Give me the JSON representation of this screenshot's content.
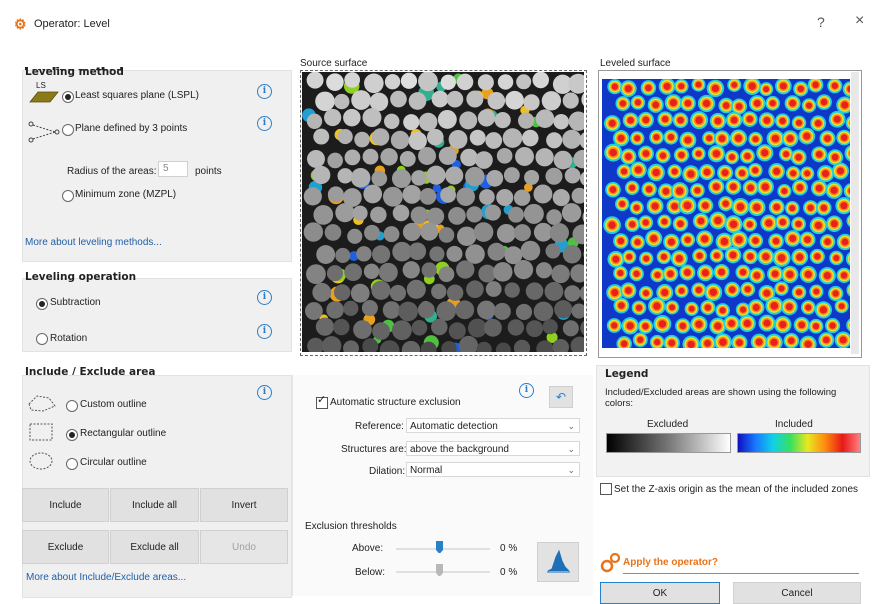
{
  "window": {
    "title": "Operator: Level",
    "help_glyph": "?",
    "close_glyph": "×"
  },
  "colors": {
    "accent": "#e8731a",
    "link": "#1f5fa8",
    "info": "#2a7fc9",
    "panel": "#f0f0f0"
  },
  "leveling_method": {
    "title": "Leveling method",
    "ls_badge": "LS",
    "options": [
      {
        "label": "Least squares plane (LSPL)",
        "selected": true
      },
      {
        "label": "Plane defined by 3 points",
        "selected": false
      },
      {
        "label": "Minimum zone (MZPL)",
        "selected": false
      }
    ],
    "radius_label": "Radius of the areas:",
    "radius_value": "5",
    "radius_unit": "points",
    "more_link": "More about leveling methods..."
  },
  "leveling_operation": {
    "title": "Leveling operation",
    "options": [
      {
        "label": "Subtraction",
        "selected": true
      },
      {
        "label": "Rotation",
        "selected": false
      }
    ]
  },
  "include_exclude": {
    "title": "Include / Exclude area",
    "options": [
      {
        "label": "Custom outline",
        "selected": false
      },
      {
        "label": "Rectangular outline",
        "selected": true
      },
      {
        "label": "Circular outline",
        "selected": false
      }
    ],
    "buttons": [
      "Include",
      "Include all",
      "Invert",
      "Exclude",
      "Exclude all",
      "Undo"
    ],
    "more_link": "More about Include/Exclude areas..."
  },
  "source_surface": {
    "title": "Source surface"
  },
  "leveled_surface": {
    "title": "Leveled surface"
  },
  "structure": {
    "auto_exclusion_label": "Automatic structure exclusion",
    "auto_exclusion_checked": true,
    "reference_label": "Reference:",
    "reference_value": "Automatic detection",
    "structures_label": "Structures are:",
    "structures_value": "above the background",
    "dilation_label": "Dilation:",
    "dilation_value": "Normal",
    "thresholds_title": "Exclusion thresholds",
    "above_label": "Above:",
    "above_value": "0 %",
    "below_label": "Below:",
    "below_value": "0 %"
  },
  "legend": {
    "title": "Legend",
    "description": "Included/Excluded areas are shown using the following colors:",
    "excluded_label": "Excluded",
    "included_label": "Included",
    "z_axis_label": "Set the Z-axis origin as the mean of the included zones",
    "z_axis_checked": false
  },
  "apply": {
    "title": "Apply the operator?",
    "ok": "OK",
    "cancel": "Cancel"
  }
}
